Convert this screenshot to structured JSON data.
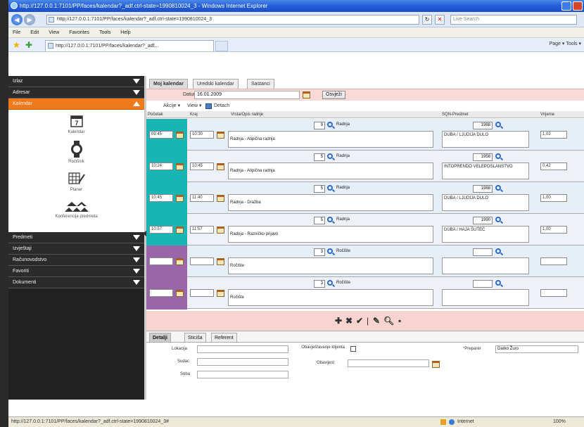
{
  "window": {
    "title": "http://127.0.0.1:7101/PP/faces/kalendar?_adf.ctrl-state=1990810024_3 - Windows Internet Explorer"
  },
  "browser": {
    "address": "http://127.0.0.1:7101/PP/faces/kalendar?_adf.ctrl-state=1990810024_3",
    "search_placeholder": "Live Search",
    "menu": [
      "File",
      "Edit",
      "View",
      "Favorites",
      "Tools",
      "Help"
    ],
    "tab_title": "http://127.0.0.1:7101/PP/faces/kalendar?_adf...",
    "commands": "Page ▾  Tools ▾",
    "status_url": "http://127.0.0.1:7101/PP/faces/kalendar?_adf.ctrl-state=1990810024_3#",
    "status_zone": "Internet",
    "status_zoom": "100%"
  },
  "sidebar": {
    "top_items": [
      "Izlaz",
      "Adresar"
    ],
    "active_item": "Kalendar",
    "panel_items": {
      "kalendar": "Kalendar",
      "kalendar_day": "7",
      "rocisnik": "Ročišnik",
      "planer": "Planer",
      "konferencije": "Konferencija predmeta"
    },
    "bottom_items": [
      "Predmeti",
      "Izvještaji",
      "Računovodstvo",
      "Favoriti",
      "Dokumenti"
    ]
  },
  "main": {
    "tabs": [
      "Moj kalendar",
      "Uredski kalendar",
      "Sastanci"
    ],
    "filter": {
      "label": "Datum",
      "date": "16.01.2009",
      "button": "Osvježi"
    },
    "toolbar": {
      "actions": "Akcije ▾",
      "view": "View ▾",
      "detach": "Detach"
    },
    "columns": [
      "Početak",
      "Kraj",
      "Vrsta/Opis radnje",
      "SQN-Predmet",
      "Vrijeme"
    ],
    "rows": [
      {
        "start": "09:45",
        "end": "10:30",
        "count": "9",
        "type": "Radnja",
        "desc": "Radnja - Atipična radnja",
        "sqn": "1988",
        "predmet": "DUBA / LJUDIJA DULO",
        "time": "1,02",
        "color": "#19b4b4"
      },
      {
        "start": "10:24",
        "end": "10:45",
        "count": "5",
        "type": "Radnja",
        "desc": "Radnja - Atipična radnja",
        "sqn": "1958",
        "predmet": "INTOPRENDO VELEPOSLANSTVO",
        "time": "0,42",
        "color": "#19b4b4"
      },
      {
        "start": "10:45",
        "end": "11:40",
        "count": "5",
        "type": "Radnja",
        "desc": "Radnja - Dražba",
        "sqn": "1988",
        "predmet": "DUBA / LJUDIJA DULO",
        "time": "1,00",
        "color": "#19b4b4"
      },
      {
        "start": "10:57",
        "end": "11:57",
        "count": "5",
        "type": "Radnja",
        "desc": "Radnja - Razničko prijavo",
        "sqn": "1990",
        "predmet": "DUBA / HAJA ŠUTEĆ",
        "time": "1,00",
        "color": "#19b4b4"
      },
      {
        "start": "",
        "end": "",
        "count": "3",
        "type": "Ročište",
        "desc": "Ročište",
        "sqn": "",
        "predmet": "",
        "time": "",
        "color": "#9966aa"
      },
      {
        "start": "",
        "end": "",
        "count": "3",
        "type": "Ročište",
        "desc": "Ročište",
        "sqn": "",
        "predmet": "",
        "time": "",
        "color": "#9966aa"
      }
    ],
    "bottom_tabs": [
      "Detalji",
      "Sticiša",
      "Referent"
    ],
    "details": {
      "lokacija_label": "Lokacija",
      "sudac_label": "Sudac",
      "soba_label": "Soba",
      "obavijesti_label": "Obavještavanje klijenta",
      "obavijest_label": "Obavijest",
      "preparer_label": "*Preparer",
      "preparer_value": "Darko Žuro"
    }
  },
  "colors": {
    "accent": "#ef7a1a",
    "sidebar_bg": "#222222",
    "filter_bg": "#f9dad6"
  }
}
